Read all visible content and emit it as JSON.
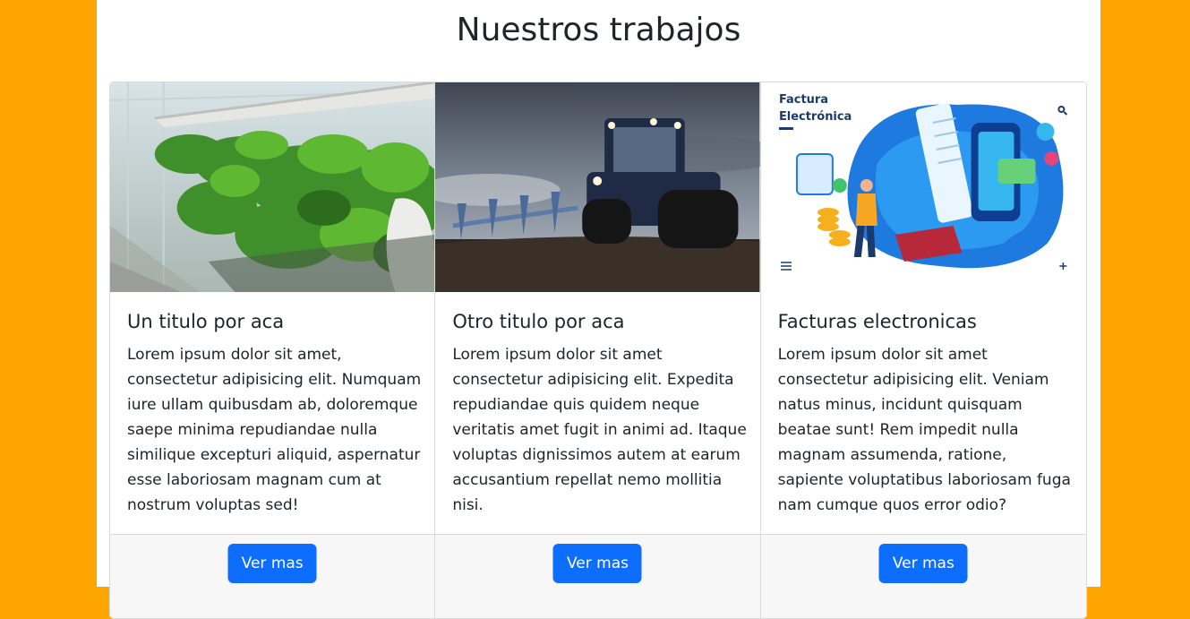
{
  "page": {
    "heading": "Nuestros trabajos",
    "background_color": "#FFA500",
    "accent_color": "#0d6efd"
  },
  "cards": [
    {
      "image": "hydroponic-greenhouse-image",
      "title": "Un titulo por aca",
      "text": "Lorem ipsum dolor sit amet, consectetur adipisicing elit. Numquam iure ullam quibusdam ab, doloremque saepe minima repudiandae nulla similique excepturi aliquid, aspernatur esse laboriosam magnam cum at nostrum voluptas sed!",
      "button": "Ver mas"
    },
    {
      "image": "tractor-plowing-image",
      "title": "Otro titulo por aca",
      "text": "Lorem ipsum dolor sit amet consectetur adipisicing elit. Expedita repudiandae quis quidem neque veritatis amet fugit in animi ad. Itaque voluptas dignissimos autem at earum accusantium repellat nemo mollitia nisi.",
      "button": "Ver mas"
    },
    {
      "image": "electronic-invoice-illustration",
      "image_caption": "Factura Electrónica",
      "title": "Facturas electronicas",
      "text": "Lorem ipsum dolor sit amet consectetur adipisicing elit. Veniam natus minus, incidunt quisquam beatae sunt! Rem impedit nulla magnam assumenda, ratione, sapiente voluptatibus laboriosam fuga nam cumque quos error odio?",
      "button": "Ver mas"
    }
  ]
}
